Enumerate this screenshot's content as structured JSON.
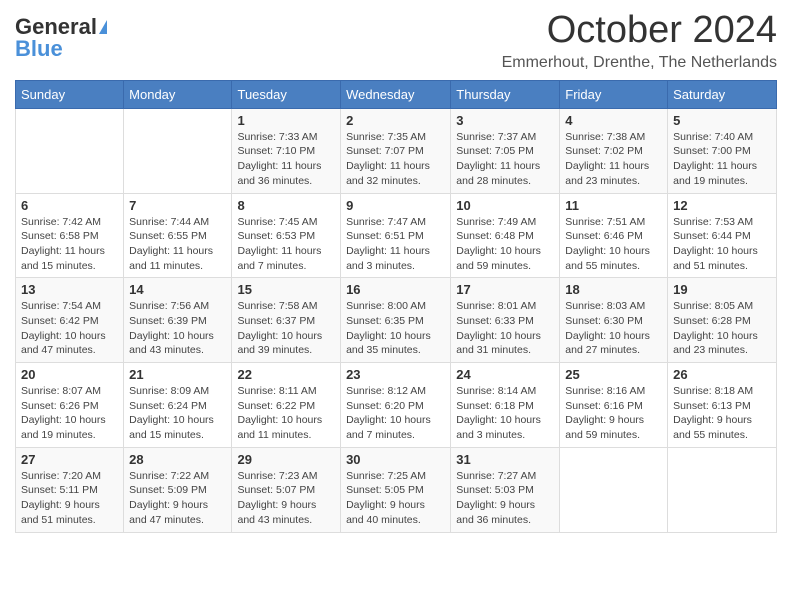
{
  "header": {
    "logo_general": "General",
    "logo_blue": "Blue",
    "month_title": "October 2024",
    "location": "Emmerhout, Drenthe, The Netherlands"
  },
  "weekdays": [
    "Sunday",
    "Monday",
    "Tuesday",
    "Wednesday",
    "Thursday",
    "Friday",
    "Saturday"
  ],
  "weeks": [
    [
      {
        "day": "",
        "info": ""
      },
      {
        "day": "",
        "info": ""
      },
      {
        "day": "1",
        "info": "Sunrise: 7:33 AM\nSunset: 7:10 PM\nDaylight: 11 hours and 36 minutes."
      },
      {
        "day": "2",
        "info": "Sunrise: 7:35 AM\nSunset: 7:07 PM\nDaylight: 11 hours and 32 minutes."
      },
      {
        "day": "3",
        "info": "Sunrise: 7:37 AM\nSunset: 7:05 PM\nDaylight: 11 hours and 28 minutes."
      },
      {
        "day": "4",
        "info": "Sunrise: 7:38 AM\nSunset: 7:02 PM\nDaylight: 11 hours and 23 minutes."
      },
      {
        "day": "5",
        "info": "Sunrise: 7:40 AM\nSunset: 7:00 PM\nDaylight: 11 hours and 19 minutes."
      }
    ],
    [
      {
        "day": "6",
        "info": "Sunrise: 7:42 AM\nSunset: 6:58 PM\nDaylight: 11 hours and 15 minutes."
      },
      {
        "day": "7",
        "info": "Sunrise: 7:44 AM\nSunset: 6:55 PM\nDaylight: 11 hours and 11 minutes."
      },
      {
        "day": "8",
        "info": "Sunrise: 7:45 AM\nSunset: 6:53 PM\nDaylight: 11 hours and 7 minutes."
      },
      {
        "day": "9",
        "info": "Sunrise: 7:47 AM\nSunset: 6:51 PM\nDaylight: 11 hours and 3 minutes."
      },
      {
        "day": "10",
        "info": "Sunrise: 7:49 AM\nSunset: 6:48 PM\nDaylight: 10 hours and 59 minutes."
      },
      {
        "day": "11",
        "info": "Sunrise: 7:51 AM\nSunset: 6:46 PM\nDaylight: 10 hours and 55 minutes."
      },
      {
        "day": "12",
        "info": "Sunrise: 7:53 AM\nSunset: 6:44 PM\nDaylight: 10 hours and 51 minutes."
      }
    ],
    [
      {
        "day": "13",
        "info": "Sunrise: 7:54 AM\nSunset: 6:42 PM\nDaylight: 10 hours and 47 minutes."
      },
      {
        "day": "14",
        "info": "Sunrise: 7:56 AM\nSunset: 6:39 PM\nDaylight: 10 hours and 43 minutes."
      },
      {
        "day": "15",
        "info": "Sunrise: 7:58 AM\nSunset: 6:37 PM\nDaylight: 10 hours and 39 minutes."
      },
      {
        "day": "16",
        "info": "Sunrise: 8:00 AM\nSunset: 6:35 PM\nDaylight: 10 hours and 35 minutes."
      },
      {
        "day": "17",
        "info": "Sunrise: 8:01 AM\nSunset: 6:33 PM\nDaylight: 10 hours and 31 minutes."
      },
      {
        "day": "18",
        "info": "Sunrise: 8:03 AM\nSunset: 6:30 PM\nDaylight: 10 hours and 27 minutes."
      },
      {
        "day": "19",
        "info": "Sunrise: 8:05 AM\nSunset: 6:28 PM\nDaylight: 10 hours and 23 minutes."
      }
    ],
    [
      {
        "day": "20",
        "info": "Sunrise: 8:07 AM\nSunset: 6:26 PM\nDaylight: 10 hours and 19 minutes."
      },
      {
        "day": "21",
        "info": "Sunrise: 8:09 AM\nSunset: 6:24 PM\nDaylight: 10 hours and 15 minutes."
      },
      {
        "day": "22",
        "info": "Sunrise: 8:11 AM\nSunset: 6:22 PM\nDaylight: 10 hours and 11 minutes."
      },
      {
        "day": "23",
        "info": "Sunrise: 8:12 AM\nSunset: 6:20 PM\nDaylight: 10 hours and 7 minutes."
      },
      {
        "day": "24",
        "info": "Sunrise: 8:14 AM\nSunset: 6:18 PM\nDaylight: 10 hours and 3 minutes."
      },
      {
        "day": "25",
        "info": "Sunrise: 8:16 AM\nSunset: 6:16 PM\nDaylight: 9 hours and 59 minutes."
      },
      {
        "day": "26",
        "info": "Sunrise: 8:18 AM\nSunset: 6:13 PM\nDaylight: 9 hours and 55 minutes."
      }
    ],
    [
      {
        "day": "27",
        "info": "Sunrise: 7:20 AM\nSunset: 5:11 PM\nDaylight: 9 hours and 51 minutes."
      },
      {
        "day": "28",
        "info": "Sunrise: 7:22 AM\nSunset: 5:09 PM\nDaylight: 9 hours and 47 minutes."
      },
      {
        "day": "29",
        "info": "Sunrise: 7:23 AM\nSunset: 5:07 PM\nDaylight: 9 hours and 43 minutes."
      },
      {
        "day": "30",
        "info": "Sunrise: 7:25 AM\nSunset: 5:05 PM\nDaylight: 9 hours and 40 minutes."
      },
      {
        "day": "31",
        "info": "Sunrise: 7:27 AM\nSunset: 5:03 PM\nDaylight: 9 hours and 36 minutes."
      },
      {
        "day": "",
        "info": ""
      },
      {
        "day": "",
        "info": ""
      }
    ]
  ]
}
